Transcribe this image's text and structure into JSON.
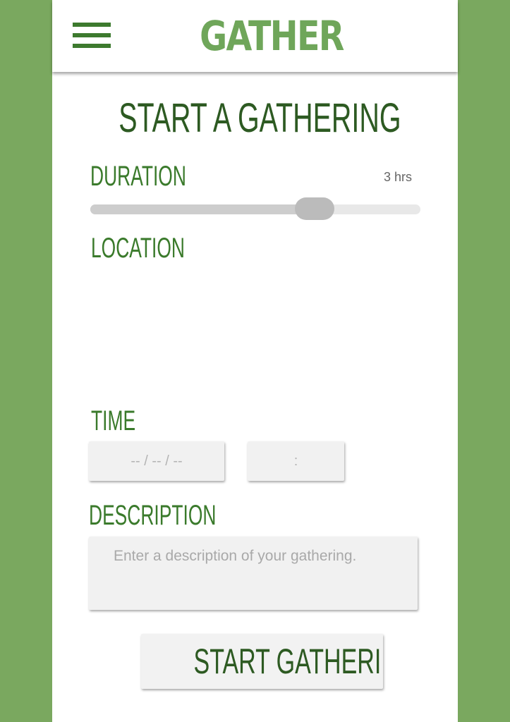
{
  "app": {
    "logo_text": "GATHER",
    "menu_icon": "hamburger-menu-icon"
  },
  "page": {
    "title": "START A GATHERING"
  },
  "duration": {
    "label": "DURATION",
    "value_text": "3 hrs",
    "slider_level_fraction": 0.68
  },
  "location": {
    "label": "LOCATION"
  },
  "time": {
    "label": "TIME",
    "date_placeholder": "-- / -- / --",
    "time_placeholder": ":"
  },
  "description": {
    "label": "DESCRIPTION",
    "placeholder": "Enter a description of your gathering."
  },
  "actions": {
    "start_label": "START GATHERING"
  },
  "colors": {
    "background_green": "#7aa85f",
    "accent_green": "#3d7a2e",
    "logo_green": "#6fa65a",
    "title_green": "#2d5a22"
  }
}
